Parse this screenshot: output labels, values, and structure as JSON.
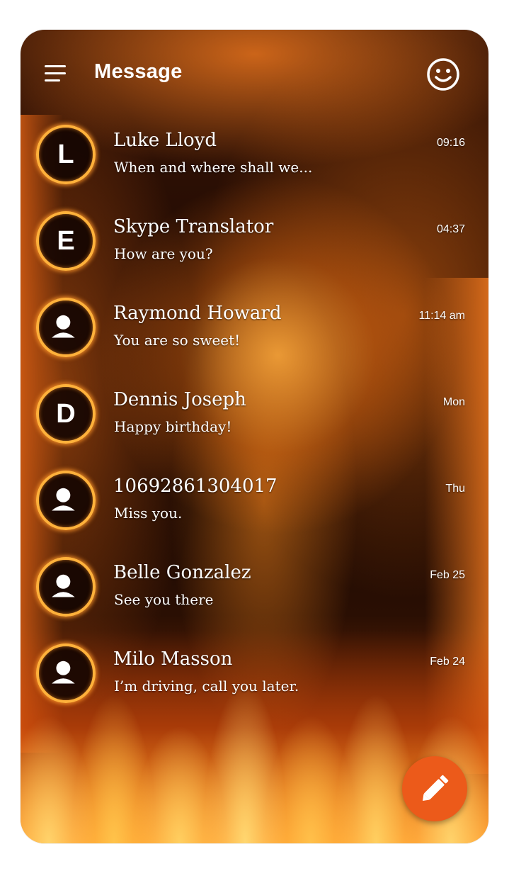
{
  "header": {
    "title": "Message",
    "menu_icon": "menu-icon",
    "emoji_icon": "smiley-icon"
  },
  "conversations": [
    {
      "avatar": "L",
      "name": "Luke Lloyd",
      "preview": "When and where shall we...",
      "time": "09:16"
    },
    {
      "avatar": "E",
      "name": "Skype Translator",
      "preview": "How are you?",
      "time": "04:37"
    },
    {
      "avatar": "",
      "name": "Raymond Howard",
      "preview": "You are so sweet!",
      "time": "11:14 am"
    },
    {
      "avatar": "D",
      "name": "Dennis Joseph",
      "preview": "Happy birthday!",
      "time": "Mon"
    },
    {
      "avatar": "",
      "name": "10692861304017",
      "preview": "Miss you.",
      "time": "Thu"
    },
    {
      "avatar": "",
      "name": "Belle Gonzalez",
      "preview": "See you there",
      "time": "Feb 25"
    },
    {
      "avatar": "",
      "name": "Milo Masson",
      "preview": "I’m driving, call you later.",
      "time": "Feb 24"
    }
  ],
  "fab": {
    "icon": "pencil-icon",
    "color": "#ec5a1a"
  },
  "theme": {
    "ring_color": "#ffb13b",
    "text_color": "#ffffff"
  }
}
